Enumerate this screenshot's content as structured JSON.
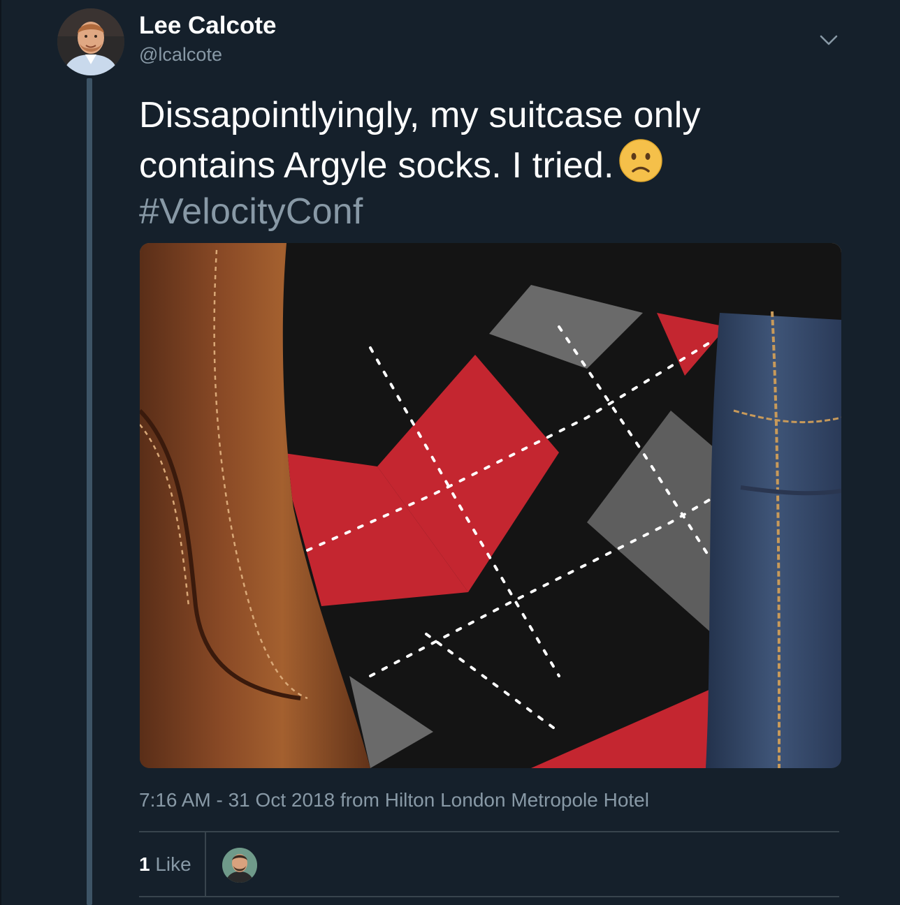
{
  "tweet": {
    "author": {
      "name": "Lee Calcote",
      "handle": "@lcalcote"
    },
    "text_lines": [
      "Dissapointlyingly, my suitcase only",
      "contains Argyle socks. I tried."
    ],
    "emoji": "slightly-frowning-face",
    "hashtag": "#VelocityConf",
    "photo_alt": "argyle socks photo",
    "timestamp": "7:16 AM - 31 Oct 2018",
    "from_label": "from",
    "location": "Hilton London Metropole Hotel",
    "likes": {
      "count": "1",
      "label": "Like"
    }
  },
  "colors": {
    "background": "#15202b",
    "muted_text": "#8899a6",
    "divider": "#38444d",
    "thread_line": "#3d5466"
  }
}
